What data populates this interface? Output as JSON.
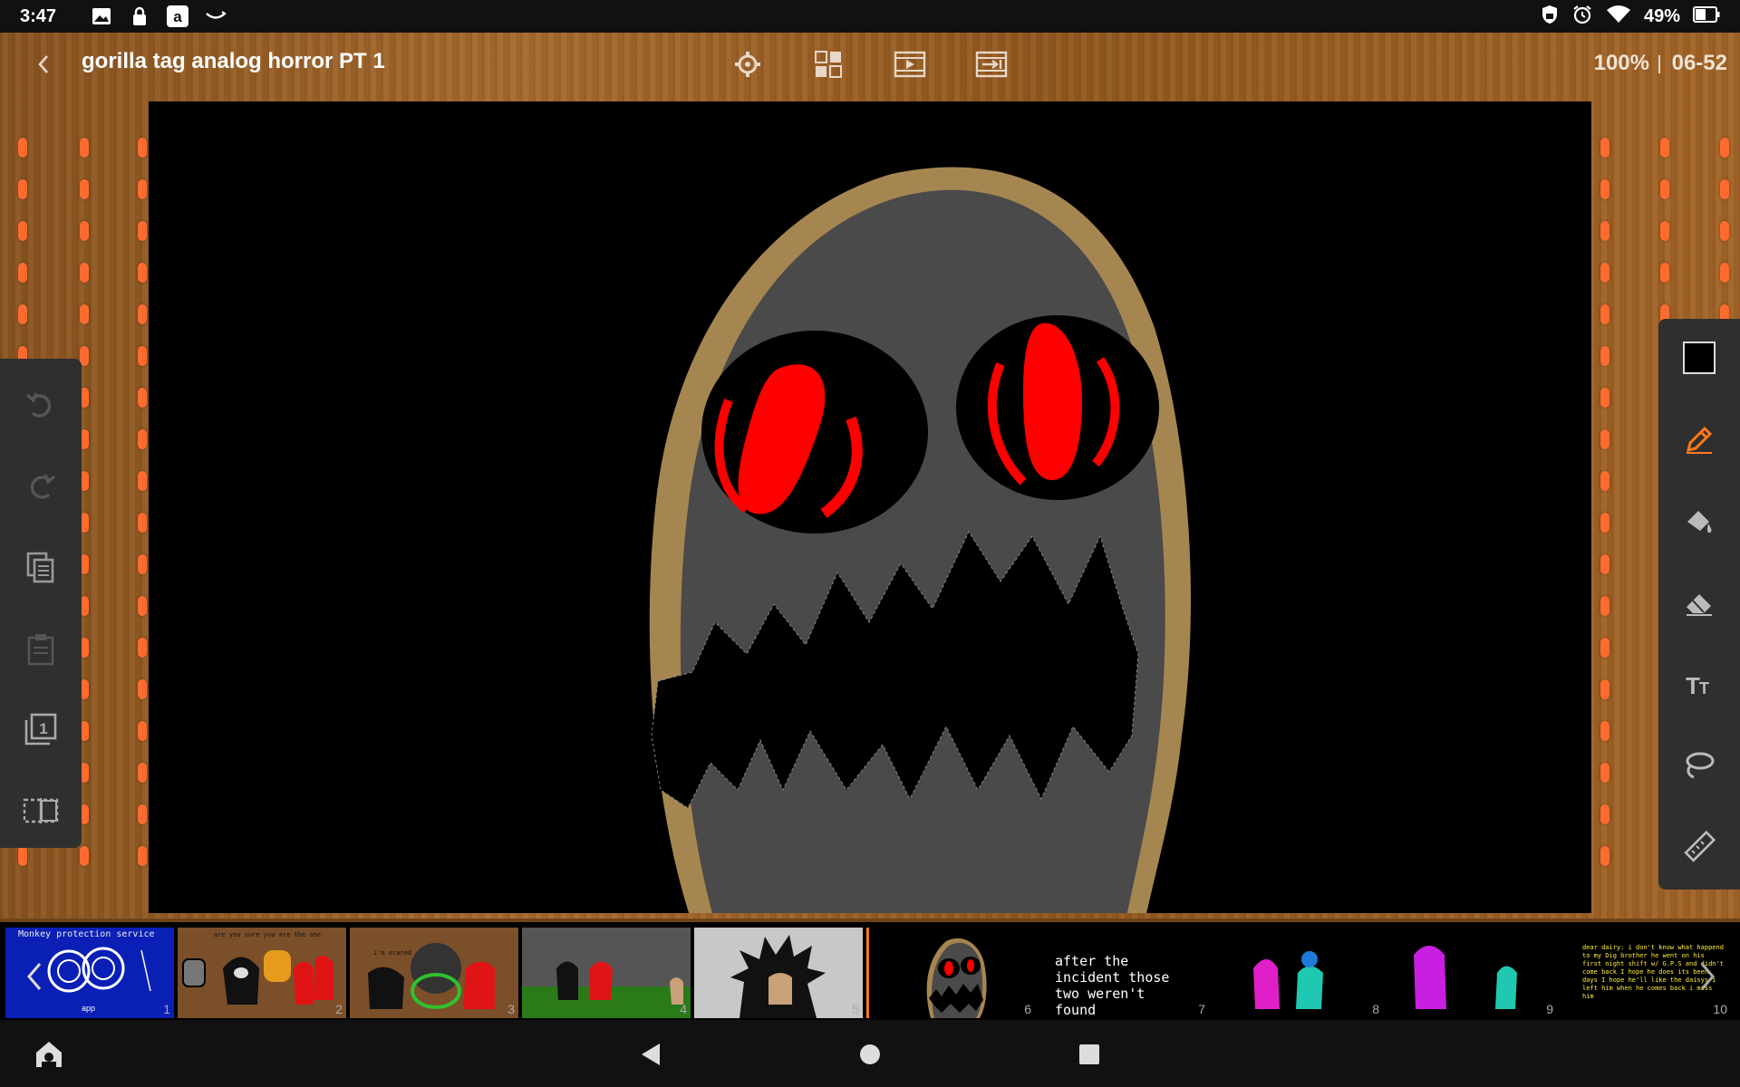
{
  "status_bar": {
    "time": "3:47",
    "battery_percent": "49%",
    "icons": [
      "gallery-icon",
      "lock-icon",
      "amazon-icon",
      "smile-icon",
      "vpn-lock-icon",
      "alarm-icon",
      "wifi-icon",
      "battery-icon"
    ]
  },
  "toolbar": {
    "title": "gorilla tag analog horror PT 1",
    "zoom": "100%",
    "frame_counter": "06-52",
    "icons": [
      "back-icon",
      "settings-icon",
      "layers-icon",
      "play-preview-icon",
      "frame-actions-icon"
    ]
  },
  "left_tools": [
    "undo-icon",
    "redo-icon",
    "copy-icon",
    "paste-icon",
    "layer-1-icon",
    "onion-skin-icon"
  ],
  "right_tools": [
    "color-swatch",
    "pencil-icon",
    "fill-icon",
    "eraser-icon",
    "text-icon",
    "lasso-icon",
    "ruler-icon"
  ],
  "colors": {
    "current_color": "#000000",
    "accent": "#ff7a1a",
    "wood": "#a06428"
  },
  "timeline": {
    "frames": [
      {
        "num": "1",
        "text": "Monkey protection service",
        "sub": "app"
      },
      {
        "num": "2",
        "text": "are you sure you are the one",
        "sub": ""
      },
      {
        "num": "3",
        "text": "i'm scared",
        "sub": ""
      },
      {
        "num": "4",
        "text": "",
        "sub": ""
      },
      {
        "num": "5",
        "text": "",
        "sub": ""
      },
      {
        "num": "6",
        "text": "",
        "sub": ""
      },
      {
        "num": "7",
        "text": "after the\nincident those\ntwo weren't\nfound",
        "sub": ""
      },
      {
        "num": "8",
        "text": "",
        "sub": ""
      },
      {
        "num": "9",
        "text": "",
        "sub": ""
      },
      {
        "num": "10",
        "text": "dear dairy: i don't know what happend to my Dig brother he went on his first night shift w/ G.P.S and didn't come back I hope he does its been days I hope he'll like the daisys i left him when he comes back i miss him",
        "sub": ""
      }
    ]
  },
  "nav_bar": [
    "home-icon",
    "back-nav-icon",
    "home-nav-icon",
    "recents-nav-icon"
  ]
}
